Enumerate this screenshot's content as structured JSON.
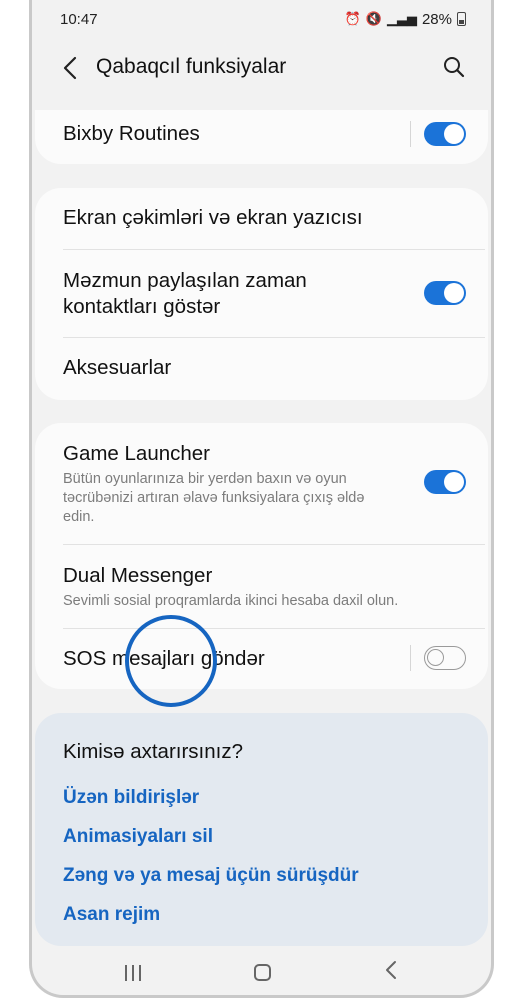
{
  "status_bar": {
    "time": "10:47",
    "battery": "28%",
    "icons": [
      "alarm-icon",
      "mute-icon",
      "signal-icon",
      "battery-icon"
    ]
  },
  "app_bar": {
    "title": "Qabaqcıl funksiyalar",
    "back_icon": "back-chevron-icon",
    "search_icon": "search-icon"
  },
  "groups": {
    "routines": {
      "label": "Bixby Routines",
      "toggle_on": true
    },
    "screenshots": {
      "label": "Ekran çəkimləri və ekran yazıcısı"
    },
    "content_share": {
      "label": "Məzmun paylaşılan zaman kontaktları göstər",
      "toggle_on": true
    },
    "accessories": {
      "label": "Aksesuarlar"
    },
    "game_launcher": {
      "label": "Game Launcher",
      "description": "Bütün oyunlarınıza bir yerdən baxın və oyun təcrübənizi artıran əlavə funksiyalara çıxış əldə edin.",
      "toggle_on": true
    },
    "dual_messenger": {
      "label": "Dual Messenger",
      "description": "Sevimli sosial proqramlarda ikinci hesaba daxil olun."
    },
    "sos": {
      "label": "SOS mesajları göndər",
      "toggle_on": false
    }
  },
  "suggestions": {
    "title": "Kimisə axtarırsınız?",
    "links": [
      "Üzən bildirişlər",
      "Animasiyaları sil",
      "Zəng və ya mesaj üçün sürüşdür",
      "Asan rejim"
    ]
  },
  "colors": {
    "accent": "#1b73d8",
    "link": "#1665c1",
    "highlight_ring": "#1665c1",
    "background": "#f2f2f2",
    "card": "#fbfbfb",
    "suggest_card": "#e3e9f0"
  },
  "nav_bar": [
    "recent-apps-icon",
    "home-icon",
    "back-icon"
  ]
}
